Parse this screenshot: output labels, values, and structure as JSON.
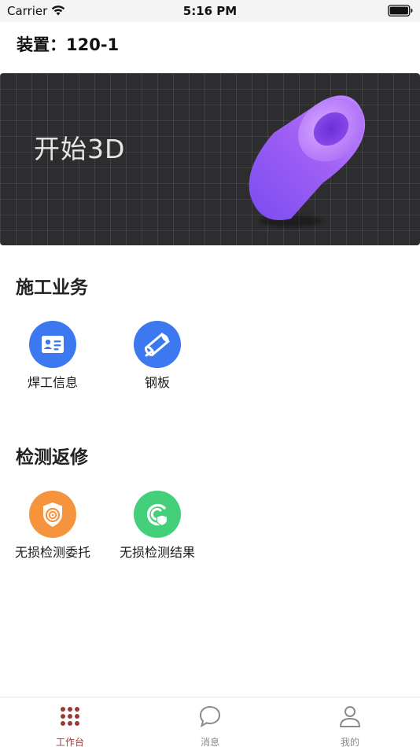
{
  "status_bar": {
    "carrier": "Carrier",
    "time": "5:16 PM"
  },
  "header": {
    "device_label": "装置：120-1"
  },
  "banner": {
    "text": "开始3D"
  },
  "sections": [
    {
      "title": "施工业务",
      "items": [
        {
          "label": "焊工信息",
          "icon": "id-card-icon",
          "color": "#3c78f0"
        },
        {
          "label": "钢板",
          "icon": "steel-plate-icon",
          "color": "#3c78f0"
        }
      ]
    },
    {
      "title": "检测返修",
      "items": [
        {
          "label": "无损检测委托",
          "icon": "shield-radar-icon",
          "color": "#f5943d"
        },
        {
          "label": "无损检测结果",
          "icon": "scan-result-icon",
          "color": "#44d07a"
        }
      ]
    }
  ],
  "tab_bar": {
    "active_color": "#9c3a38",
    "tabs": [
      {
        "label": "工作台",
        "icon": "grid-dots-icon",
        "active": true
      },
      {
        "label": "消息",
        "icon": "chat-bubble-icon",
        "active": false
      },
      {
        "label": "我的",
        "icon": "person-icon",
        "active": false
      }
    ]
  }
}
